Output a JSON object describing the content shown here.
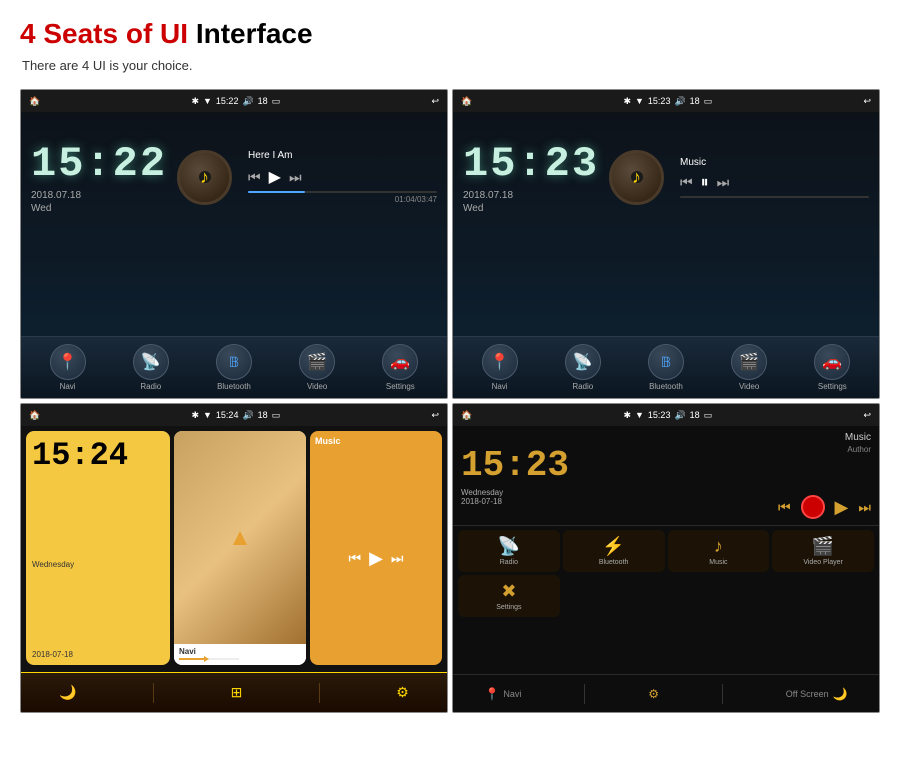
{
  "header": {
    "title_red": "4 Seats of UI",
    "title_black": "Interface",
    "subtitle": "There are 4 UI is your choice."
  },
  "screens": [
    {
      "id": "screen1",
      "status": {
        "time": "15:22",
        "battery": "18",
        "bluetooth": "✱",
        "signal": "▼"
      },
      "clock": "15:22",
      "date": "2018.07.18",
      "day": "Wed",
      "song": "Here I Am",
      "elapsed": "01:04/03:47",
      "progress": 28,
      "nav_items": [
        "Navi",
        "Radio",
        "Bluetooth",
        "Video",
        "Settings"
      ]
    },
    {
      "id": "screen2",
      "status": {
        "time": "15:23",
        "battery": "18"
      },
      "clock": "15:23",
      "date": "2018.07.18",
      "day": "Wed",
      "song": "Music",
      "nav_items": [
        "Navi",
        "Radio",
        "Bluetooth",
        "Video",
        "Settings"
      ]
    },
    {
      "id": "screen3",
      "status": {
        "time": "15:24",
        "battery": "18"
      },
      "clock": "15:24",
      "date": "Wednesday\n2018-07-18",
      "cards": [
        "Navi",
        "Music"
      ],
      "nav_items": [
        "moon",
        "grid",
        "settings"
      ]
    },
    {
      "id": "screen4",
      "status": {
        "time": "15:23",
        "battery": "18"
      },
      "clock": "15:23",
      "date_line1": "Wednesday",
      "date_line2": "2018-07-18",
      "music_title": "Music",
      "music_author": "Author",
      "icon_items": [
        {
          "icon": "📡",
          "label": "Radio"
        },
        {
          "icon": "🔵",
          "label": "Bluetooth"
        },
        {
          "icon": "🎵",
          "label": "Music"
        },
        {
          "icon": "🎬",
          "label": "Video Player"
        },
        {
          "icon": "⚙",
          "label": "Settings"
        }
      ],
      "bottom_items": [
        "Navi",
        "Off Screen"
      ]
    }
  ]
}
